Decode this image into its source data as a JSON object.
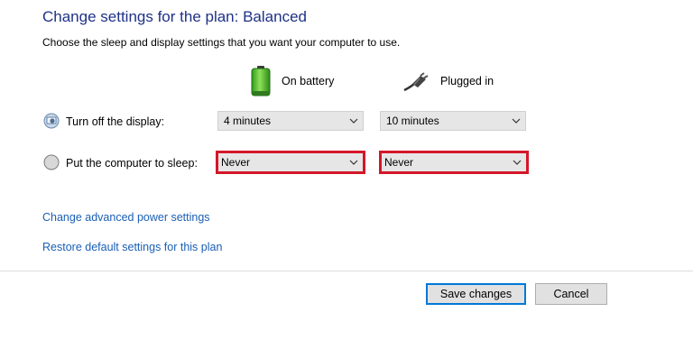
{
  "header": {
    "title": "Change settings for the plan: Balanced",
    "subtitle": "Choose the sleep and display settings that you want your computer to use."
  },
  "columns": {
    "on_battery": "On battery",
    "plugged_in": "Plugged in"
  },
  "settings": {
    "display": {
      "label": "Turn off the display:",
      "on_battery": "4 minutes",
      "plugged_in": "10 minutes"
    },
    "sleep": {
      "label": "Put the computer to sleep:",
      "on_battery": "Never",
      "plugged_in": "Never"
    }
  },
  "links": {
    "advanced": "Change advanced power settings",
    "restore": "Restore default settings for this plan"
  },
  "buttons": {
    "save": "Save changes",
    "cancel": "Cancel"
  },
  "colors": {
    "title": "#1e3287",
    "link": "#1a5fb4",
    "highlight": "#d4172a",
    "primary_border": "#0078d7"
  }
}
